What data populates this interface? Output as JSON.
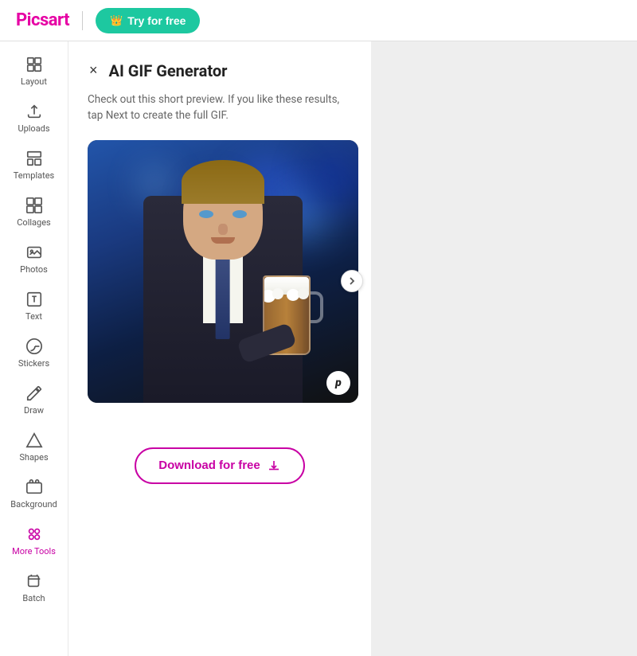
{
  "header": {
    "logo": "Picsart",
    "divider": true,
    "try_button": {
      "label": "Try for free",
      "icon": "crown"
    }
  },
  "sidebar": {
    "items": [
      {
        "id": "layout",
        "label": "Layout",
        "icon": "layout"
      },
      {
        "id": "uploads",
        "label": "Uploads",
        "icon": "uploads"
      },
      {
        "id": "templates",
        "label": "Templates",
        "icon": "templates"
      },
      {
        "id": "collages",
        "label": "Collages",
        "icon": "collages"
      },
      {
        "id": "photos",
        "label": "Photos",
        "icon": "photos"
      },
      {
        "id": "text",
        "label": "Text",
        "icon": "text"
      },
      {
        "id": "stickers",
        "label": "Stickers",
        "icon": "stickers"
      },
      {
        "id": "draw",
        "label": "Draw",
        "icon": "draw"
      },
      {
        "id": "shapes",
        "label": "Shapes",
        "icon": "shapes"
      },
      {
        "id": "background",
        "label": "Background",
        "icon": "background"
      },
      {
        "id": "more-tools",
        "label": "More Tools",
        "icon": "more-tools",
        "active": true
      },
      {
        "id": "batch",
        "label": "Batch",
        "icon": "batch"
      }
    ]
  },
  "panel": {
    "title": "AI GIF Generator",
    "close_label": "×",
    "description": "Check out this short preview. If you like these results, tap Next to create the full GIF.",
    "download_button": {
      "label": "Download for free",
      "icon": "download"
    },
    "watermark": "p"
  }
}
